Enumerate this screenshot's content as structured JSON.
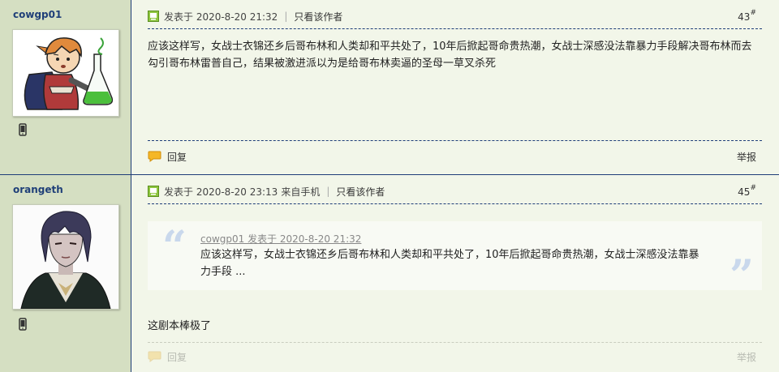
{
  "posts": [
    {
      "username": "cowgp01",
      "meta": {
        "posted": "发表于 2020-8-20 21:32",
        "source": "",
        "only_author": "只看该作者"
      },
      "floor": "43",
      "floor_mark": "#",
      "content": "应该这样写，女战士衣锦还乡后哥布林和人类却和平共处了，10年后掀起哥命贵热潮，女战士深感没法靠暴力手段解决哥布林而去勾引哥布林雷普自己，结果被激进派以为是给哥布林卖逼的圣母一草叉杀死",
      "reply_label": "回复",
      "report_label": "举报"
    },
    {
      "username": "orangeth",
      "meta": {
        "posted": "发表于 2020-8-20 23:13",
        "source": "来自手机",
        "only_author": "只看该作者"
      },
      "floor": "45",
      "floor_mark": "#",
      "quote": {
        "head": "cowgp01 发表于 2020-8-20 21:32",
        "body": "应该这样写，女战士衣锦还乡后哥布林和人类却和平共处了，10年后掀起哥命贵热潮，女战士深感没法靠暴力手段 ..."
      },
      "content": "这剧本棒极了",
      "reply_label": "回复",
      "report_label": "举报"
    }
  ],
  "icons": {
    "online": "online-status-icon",
    "phone": "mobile-phone-icon",
    "reply": "reply-bubble-icon"
  },
  "colors": {
    "border": "#1e3d78",
    "sidebar": "#d5dfc2",
    "background": "#f2f6e9",
    "username": "#1f3f78",
    "quote_marks": "#c9d8ec"
  }
}
